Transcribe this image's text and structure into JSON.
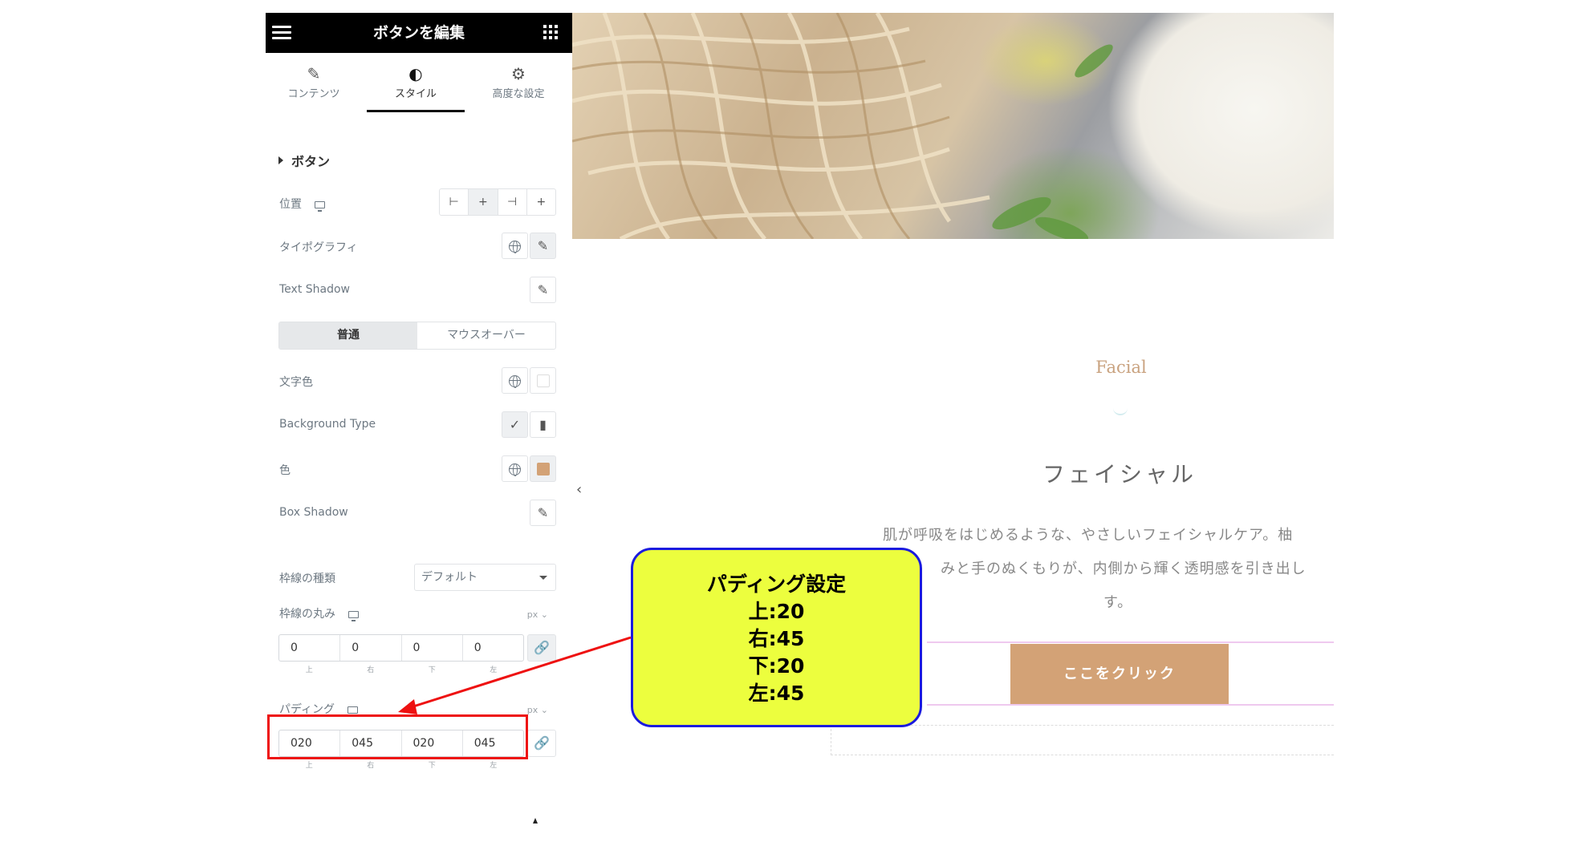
{
  "panel": {
    "title": "ボタンを編集",
    "tabs": [
      {
        "icon": "pencil-icon",
        "label": "コンテンツ"
      },
      {
        "icon": "contrast-icon",
        "label": "スタイル"
      },
      {
        "icon": "gear-icon",
        "label": "高度な設定"
      }
    ],
    "section_title": "ボタン",
    "position_label": "位置",
    "typography_label": "タイポグラフィ",
    "text_shadow_label": "Text Shadow",
    "state_tabs": [
      "普通",
      "マウスオーバー"
    ],
    "text_color_label": "文字色",
    "background_type_label": "Background Type",
    "color_label": "色",
    "box_shadow_label": "Box Shadow",
    "border_type_label": "枠線の種類",
    "border_type_value": "デフォルト",
    "border_radius_label": "枠線の丸み",
    "border_radius_unit": "px ⌄",
    "border_radius_values": [
      "0",
      "0",
      "0",
      "0"
    ],
    "dim_sublabels": [
      "上",
      "右",
      "下",
      "左"
    ],
    "padding_label": "パディング",
    "padding_unit": "px ⌄",
    "padding_values": [
      "020",
      "045",
      "020",
      "045"
    ],
    "colors": {
      "text_color": "#ffffff",
      "bg_color": "#d3a276"
    }
  },
  "preview": {
    "eyebrow": "Facial",
    "heading": "フェイシャル",
    "paragraph_lines": [
      "肌が呼吸をはじめるような、やさしいフェイシャルケア。柚",
      "みと手のぬくもりが、内側から輝く透明感を引き出し",
      "す。"
    ],
    "button_label": "ここをクリック",
    "button_color": "#d3a276"
  },
  "callout": {
    "title": "パディング設定",
    "lines": [
      "上:20",
      "右:45",
      "下:20",
      "左:45"
    ]
  }
}
